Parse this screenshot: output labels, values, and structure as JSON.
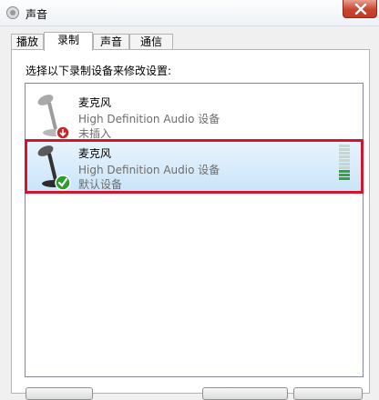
{
  "window": {
    "title": "声音"
  },
  "tabs": [
    {
      "label": "播放",
      "active": false
    },
    {
      "label": "录制",
      "active": true
    },
    {
      "label": "声音",
      "active": false
    },
    {
      "label": "通信",
      "active": false
    }
  ],
  "recording": {
    "instruction": "选择以下录制设备来修改设置:",
    "devices": [
      {
        "name": "麦克风",
        "description": "High Definition Audio 设备",
        "status": "未插入",
        "badge_icon": "unplugged-icon",
        "selected": false
      },
      {
        "name": "麦克风",
        "description": "High Definition Audio 设备",
        "status": "默认设备",
        "badge_icon": "default-check-icon",
        "selected": true
      }
    ]
  },
  "colors": {
    "selection_outline": "#d3162e",
    "meter_on": "#34a33f",
    "default_badge": "#2e9c2c",
    "unplugged_badge": "#c8272a"
  }
}
